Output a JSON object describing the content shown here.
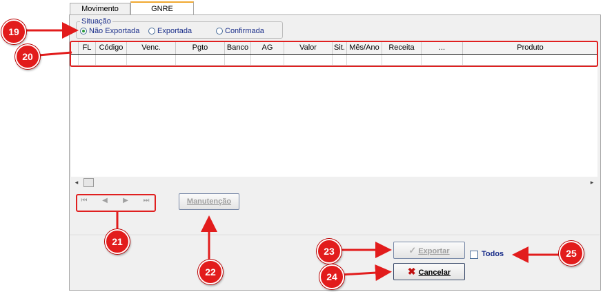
{
  "tabs": [
    {
      "label": "Movimento",
      "active": false
    },
    {
      "label": "GNRE",
      "active": true
    }
  ],
  "situacao": {
    "label": "Situação",
    "options": [
      {
        "label": "Não Exportada",
        "selected": true
      },
      {
        "label": "Exportada",
        "selected": false
      },
      {
        "label": "Confirmada",
        "selected": false
      }
    ]
  },
  "grid": {
    "columns": [
      "FL",
      "Código",
      "Venc.",
      "Pgto",
      "Banco",
      "AG",
      "Valor",
      "Sit.",
      "Mês/Ano",
      "Receita",
      "...",
      "Produto"
    ]
  },
  "scroll": {
    "left_arrow": "◂",
    "right_arrow": "▸"
  },
  "nav": {
    "first": "⏮",
    "prev": "◀",
    "next": "▶",
    "last": "⏭"
  },
  "buttons": {
    "manutencao": "Manutenção",
    "exportar": "Exportar",
    "cancelar": "Cancelar",
    "todos": "Todos"
  },
  "annotations": [
    "19",
    "20",
    "21",
    "22",
    "23",
    "24",
    "25"
  ],
  "colors": {
    "accent_red": "#e21c1c",
    "radio_text": "#1a2e8a",
    "tab_highlight": "#f0a830"
  }
}
